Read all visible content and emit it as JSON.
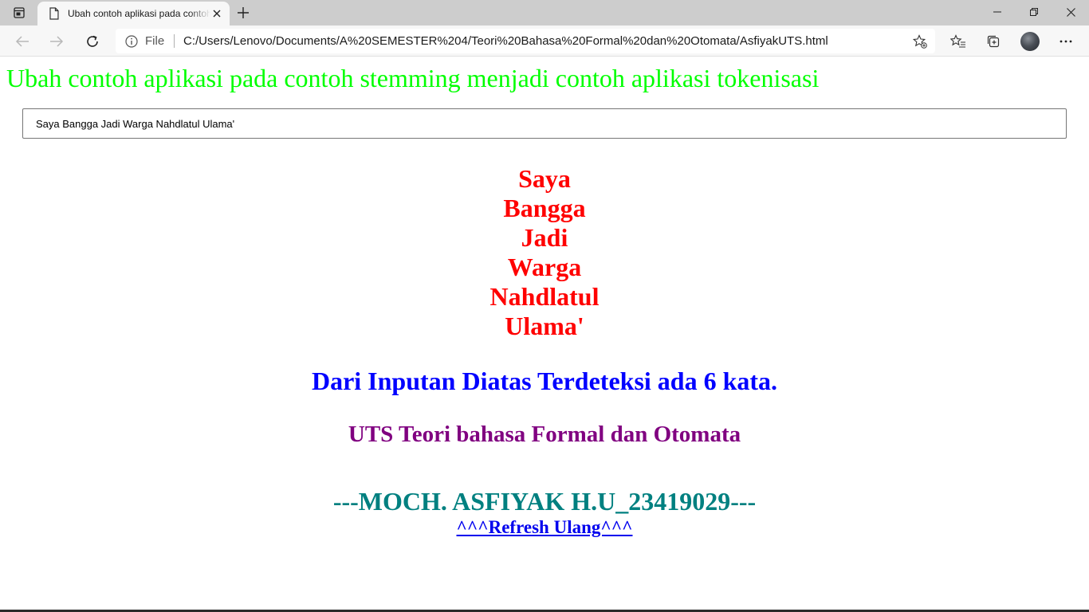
{
  "browser": {
    "tab_title": "Ubah contoh aplikasi pada contoh stemming menjadi contoh aplikasi tokenisasi",
    "address_scheme_label": "File",
    "url": "C:/Users/Lenovo/Documents/A%20SEMESTER%204/Teori%20Bahasa%20Formal%20dan%20Otomata/AsfiyakUTS.html"
  },
  "page": {
    "heading": "Ubah contoh aplikasi pada contoh stemming menjadi contoh aplikasi tokenisasi",
    "input_value": "Saya Bangga Jadi Warga Nahdlatul Ulama'",
    "tokens": [
      "Saya",
      "Bangga",
      "Jadi",
      "Warga",
      "Nahdlatul",
      "Ulama'"
    ],
    "result_text": "Dari Inputan Diatas Terdeteksi ada 6 kata.",
    "subtitle": "UTS Teori bahasa Formal dan Otomata",
    "author": "---MOCH. ASFIYAK H.U_23419029---",
    "refresh_link": "^^^Refresh Ulang^^^"
  },
  "colors": {
    "heading": "#00ff00",
    "tokens": "#ff0000",
    "result": "#0000ff",
    "subtitle": "#800080",
    "author": "#008080",
    "link": "#0000ee"
  }
}
